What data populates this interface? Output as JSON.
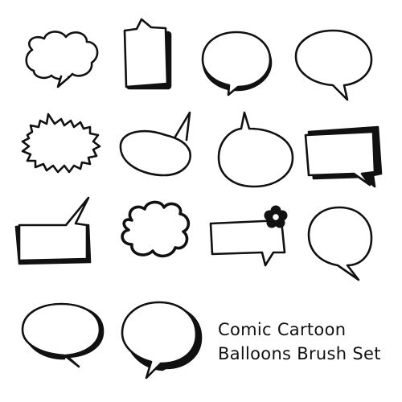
{
  "caption": {
    "line1": "Comic Cartoon",
    "line2": "Balloons Brush Set"
  },
  "colors": {
    "background": "#ffffff",
    "ink": "#111111"
  },
  "balloons": [
    "cloud-balloon-icon",
    "tall-rect-balloon-icon",
    "oval-balloon-icon",
    "oval-tail-balloon-icon",
    "spiky-shout-balloon-icon",
    "tilted-oval-balloon-icon",
    "round-tail-up-balloon-icon",
    "3d-box-balloon-icon",
    "rect-tail-up-balloon-icon",
    "bold-cloud-balloon-icon",
    "flower-rect-balloon-icon",
    "round-balloon-icon",
    "wide-oval-balloon-icon",
    "rounded-balloon-icon"
  ]
}
